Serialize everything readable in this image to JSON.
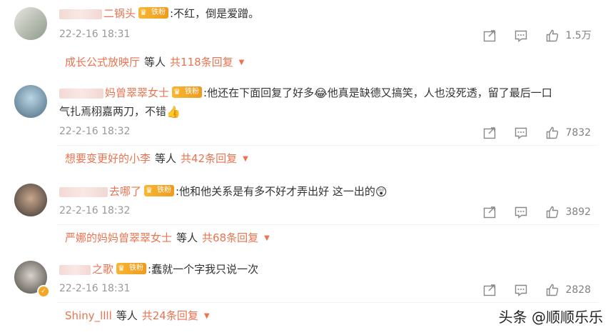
{
  "comments": [
    {
      "name_suffix": "二锅头",
      "badge": "铁粉",
      "text": ":不红，倒是爱蹭。",
      "line2": "",
      "date": "22-2-16 18:31",
      "likes": "1.5万",
      "reply_user": "成长公式放映厅",
      "reply_mid": "等人",
      "reply_count": "共118条回复"
    },
    {
      "name_suffix": "妈曾翠翠女士",
      "badge": "铁粉",
      "text": ":他还在下面回复了好多",
      "text2": "他真是缺德又搞笑，人也没死透，留了最后一口",
      "line2": "气扎焉栩嘉两刀，不错",
      "date": "22-2-16 18:32",
      "likes": "7832",
      "reply_user": "想要变更好的小李",
      "reply_mid": "等人",
      "reply_count": "共42条回复"
    },
    {
      "name_suffix": "去哪了",
      "badge": "铁粉",
      "text": ":他和他关系是有多不好才弄出好 这一出的",
      "line2": "",
      "date": "22-2-16 18:32",
      "likes": "3892",
      "reply_user": "严娜的妈妈曾翠翠女士",
      "reply_mid": "等人",
      "reply_count": "共68条回复"
    },
    {
      "name_suffix": "之歌",
      "badge": "铁粉",
      "text": ":蠢就一个字我只说一次",
      "line2": "",
      "date": "22-2-16 18:31",
      "likes": "2828",
      "reply_user": "Shiny_llll",
      "reply_mid": "等人",
      "reply_count": "共24条回复"
    }
  ],
  "watermark": "头条 @顺顺乐乐",
  "icons": [
    "share-icon",
    "comment-icon",
    "like-icon",
    "emoji-icon",
    "thumbs-up-emoji-icon",
    "crown-icon",
    "verified-icon",
    "caret-down-icon"
  ],
  "colors": {
    "accent": "#eb7350",
    "muted": "#999999",
    "badge": "#f5a623"
  }
}
